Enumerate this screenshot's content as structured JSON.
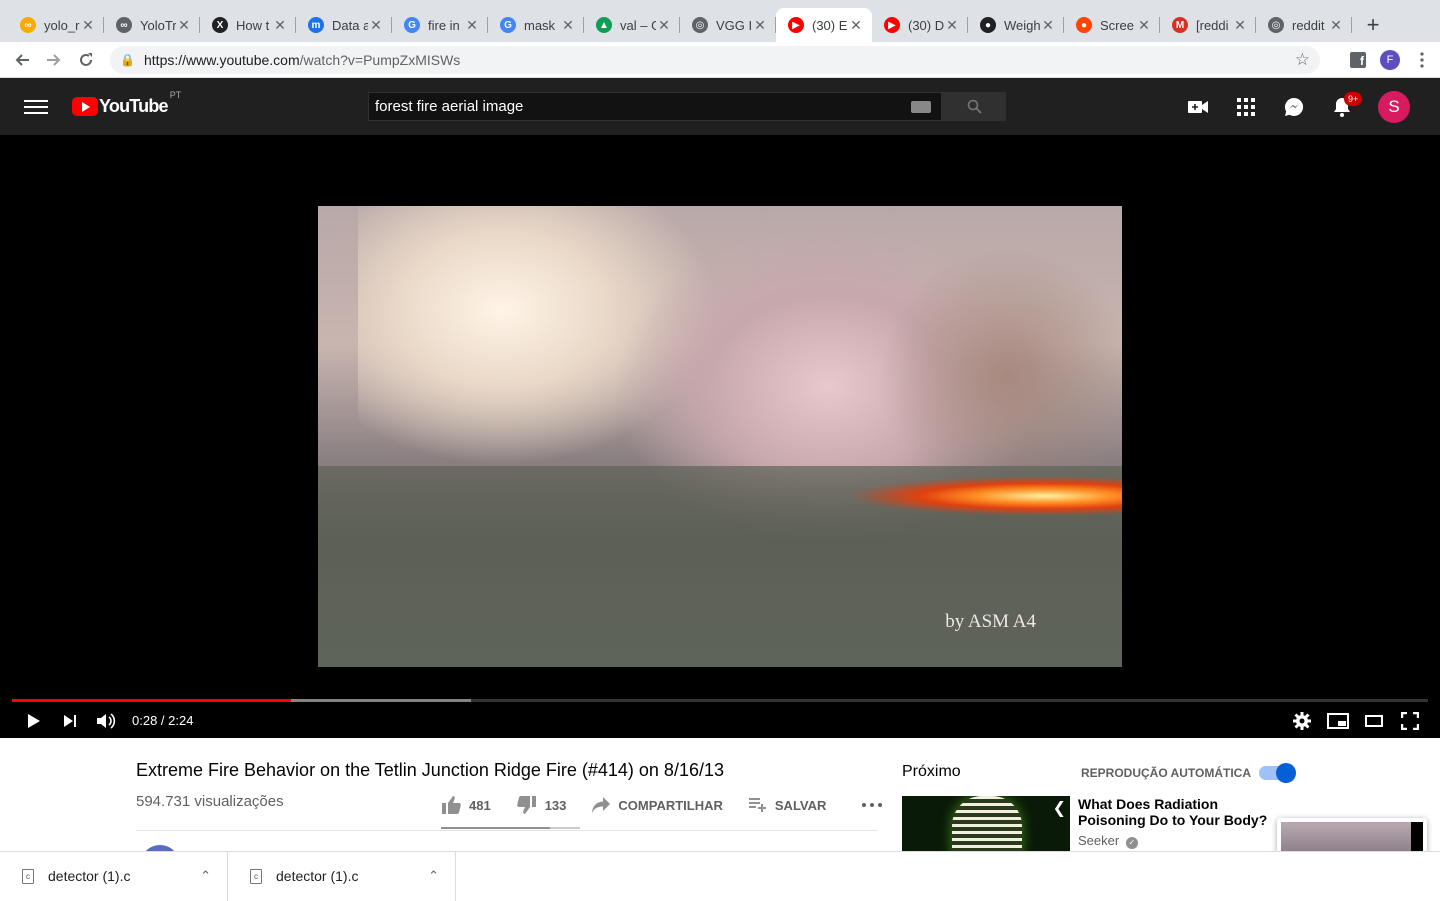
{
  "browser": {
    "tabs": [
      {
        "label": "yolo_r",
        "fav": "∞",
        "fav_color": "#f9ab00"
      },
      {
        "label": "YoloTr",
        "fav": "∞",
        "fav_color": "#5f6368"
      },
      {
        "label": "How t",
        "fav": "X",
        "fav_color": "#202124"
      },
      {
        "label": "Data a",
        "fav": "m",
        "fav_color": "#1a73e8"
      },
      {
        "label": "fire in",
        "fav": "G",
        "fav_color": "#4285f4"
      },
      {
        "label": "mask",
        "fav": "G",
        "fav_color": "#4285f4"
      },
      {
        "label": "val – G",
        "fav": "▲",
        "fav_color": "#0f9d58"
      },
      {
        "label": "VGG I",
        "fav": "◎",
        "fav_color": "#5f6368"
      },
      {
        "label": "(30) E",
        "fav": "▶",
        "fav_color": "#ff0000",
        "active": true
      },
      {
        "label": "(30) D",
        "fav": "▶",
        "fav_color": "#ff0000"
      },
      {
        "label": "Weigh",
        "fav": "●",
        "fav_color": "#202124"
      },
      {
        "label": "Scree",
        "fav": "●",
        "fav_color": "#ff4500"
      },
      {
        "label": "[reddi",
        "fav": "M",
        "fav_color": "#d93025"
      },
      {
        "label": "reddit",
        "fav": "◎",
        "fav_color": "#5f6368"
      }
    ],
    "new_tab": "+",
    "url_host": "https://www.youtube.com",
    "url_path": "/watch?v=PumpZxMISWs",
    "profile_initial": "F"
  },
  "youtube": {
    "country": "PT",
    "logo_text": "YouTube",
    "search_query": "forest fire aerial image",
    "notifications_badge": "9+",
    "avatar_initial": "S"
  },
  "player": {
    "watermark": "by ASM A4",
    "time": "0:28 / 2:24",
    "played_fraction": 0.197,
    "buffered_fraction": 0.324
  },
  "video": {
    "title": "Extreme Fire Behavior on the Tetlin Junction Ridge Fire (#414) on 8/16/13",
    "views": "594.731 visualizações",
    "likes": "481",
    "dislikes": "133",
    "share_label": "COMPARTILHAR",
    "save_label": "SALVAR"
  },
  "sidebar": {
    "next_label": "Próximo",
    "autoplay_label": "REPRODUÇÃO AUTOMÁTICA",
    "autoplay_on": true,
    "rec_title": "What Does Radiation Poisoning Do to Your Body?",
    "rec_channel": "Seeker"
  },
  "downloads": [
    {
      "name": "detector (1).c"
    },
    {
      "name": "detector (1).c"
    }
  ]
}
